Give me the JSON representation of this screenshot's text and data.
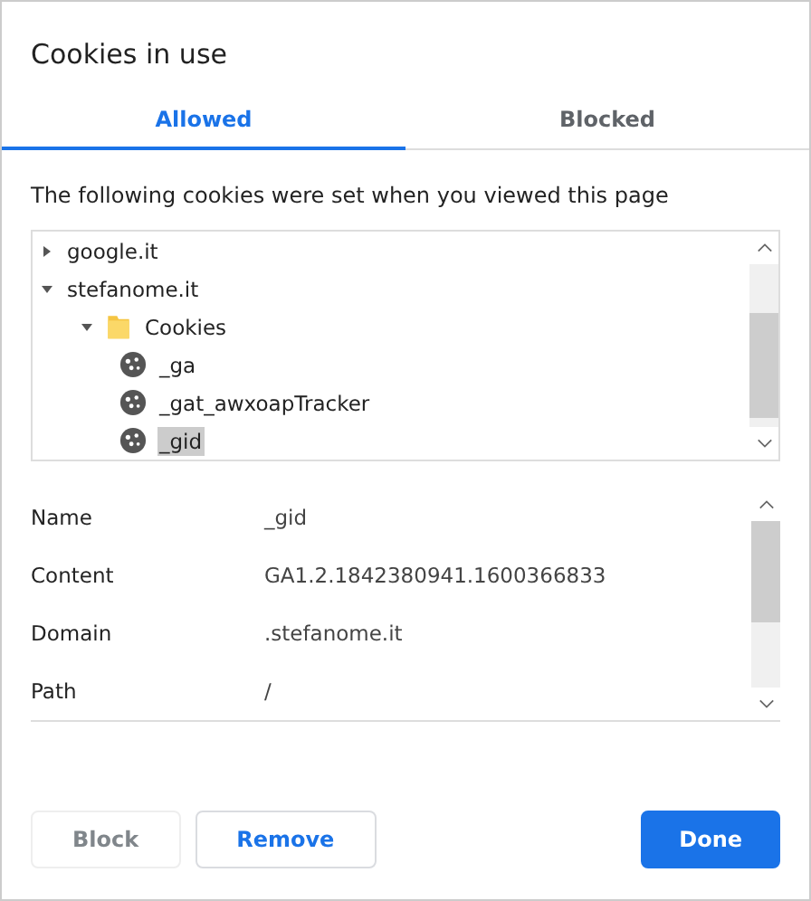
{
  "dialog": {
    "title": "Cookies in use"
  },
  "tabs": [
    {
      "label": "Allowed",
      "selected": true
    },
    {
      "label": "Blocked",
      "selected": false
    }
  ],
  "description": "The following cookies were set when you viewed this page",
  "tree": [
    {
      "kind": "site",
      "label": "google.it",
      "expanded": false,
      "selected": false
    },
    {
      "kind": "site",
      "label": "stefanome.it",
      "expanded": true,
      "selected": false,
      "children": [
        {
          "kind": "folder",
          "label": "Cookies",
          "expanded": true,
          "selected": false,
          "children": [
            {
              "kind": "cookie",
              "label": "_ga",
              "selected": false
            },
            {
              "kind": "cookie",
              "label": "_gat_awxoapTracker",
              "selected": false
            },
            {
              "kind": "cookie",
              "label": "_gid",
              "selected": true
            }
          ]
        }
      ]
    }
  ],
  "details": [
    {
      "label": "Name",
      "value": "_gid"
    },
    {
      "label": "Content",
      "value": "GA1.2.1842380941.1600366833"
    },
    {
      "label": "Domain",
      "value": ".stefanome.it"
    },
    {
      "label": "Path",
      "value": "/"
    }
  ],
  "buttons": [
    {
      "label": "Block",
      "kind": "secondary",
      "disabled": true
    },
    {
      "label": "Remove",
      "kind": "secondary",
      "disabled": false
    },
    {
      "label": "Done",
      "kind": "primary",
      "disabled": false
    }
  ]
}
